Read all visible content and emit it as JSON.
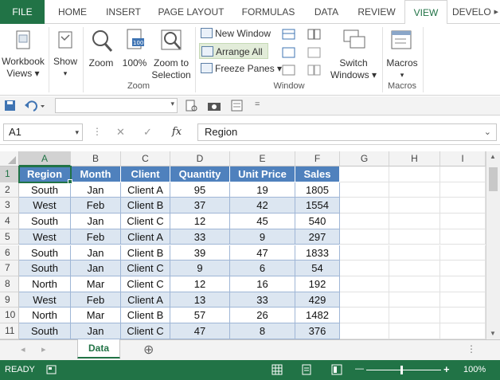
{
  "ribbon_tabs": [
    "FILE",
    "HOME",
    "INSERT",
    "PAGE LAYOUT",
    "FORMULAS",
    "DATA",
    "REVIEW",
    "VIEW",
    "DEVELO"
  ],
  "active_tab": "VIEW",
  "ribbon": {
    "workbook_views": {
      "line1": "Workbook",
      "line2": "Views ▾"
    },
    "show": {
      "label": "Show",
      "arrow": "▾"
    },
    "zoom": {
      "label": "Zoom"
    },
    "zoom100": {
      "label": "100%"
    },
    "zoom_selection": {
      "line1": "Zoom to",
      "line2": "Selection"
    },
    "zoom_group": "Zoom",
    "new_window": "New Window",
    "arrange_all": "Arrange All",
    "freeze_panes": "Freeze Panes ▾",
    "switch_windows": {
      "line1": "Switch",
      "line2": "Windows ▾"
    },
    "window_group": "Window",
    "macros": {
      "label": "Macros",
      "arrow": "▾"
    },
    "macros_group": "Macros"
  },
  "qat": {
    "more": "="
  },
  "formula_bar": {
    "name_box": "A1",
    "cancel": "✕",
    "enter": "✓",
    "fx": "fx",
    "value": "Region"
  },
  "columns": [
    "A",
    "B",
    "C",
    "D",
    "E",
    "F",
    "G",
    "H",
    "I"
  ],
  "row_numbers": [
    "1",
    "2",
    "3",
    "4",
    "5",
    "6",
    "7",
    "8",
    "9",
    "10",
    "11"
  ],
  "table": {
    "headers": [
      "Region",
      "Month",
      "Client",
      "Quantity",
      "Unit Price",
      "Sales"
    ],
    "rows": [
      [
        "South",
        "Jan",
        "Client A",
        "95",
        "19",
        "1805"
      ],
      [
        "West",
        "Feb",
        "Client B",
        "37",
        "42",
        "1554"
      ],
      [
        "South",
        "Jan",
        "Client C",
        "12",
        "45",
        "540"
      ],
      [
        "West",
        "Feb",
        "Client A",
        "33",
        "9",
        "297"
      ],
      [
        "South",
        "Jan",
        "Client B",
        "39",
        "47",
        "1833"
      ],
      [
        "South",
        "Jan",
        "Client C",
        "9",
        "6",
        "54"
      ],
      [
        "North",
        "Mar",
        "Client C",
        "12",
        "16",
        "192"
      ],
      [
        "West",
        "Feb",
        "Client A",
        "13",
        "33",
        "429"
      ],
      [
        "North",
        "Mar",
        "Client B",
        "57",
        "26",
        "1482"
      ],
      [
        "South",
        "Jan",
        "Client C",
        "47",
        "8",
        "376"
      ]
    ]
  },
  "sheet_tabs": {
    "active": "Data",
    "add": "⊕",
    "prev": "◂",
    "next": "▸",
    "menu": "⋮"
  },
  "status": {
    "ready": "READY",
    "zoom": "100%",
    "minus": "—",
    "plus": "+"
  },
  "colors": {
    "accent": "#217346",
    "table_header": "#4f81bd",
    "table_band": "#dce6f1"
  }
}
